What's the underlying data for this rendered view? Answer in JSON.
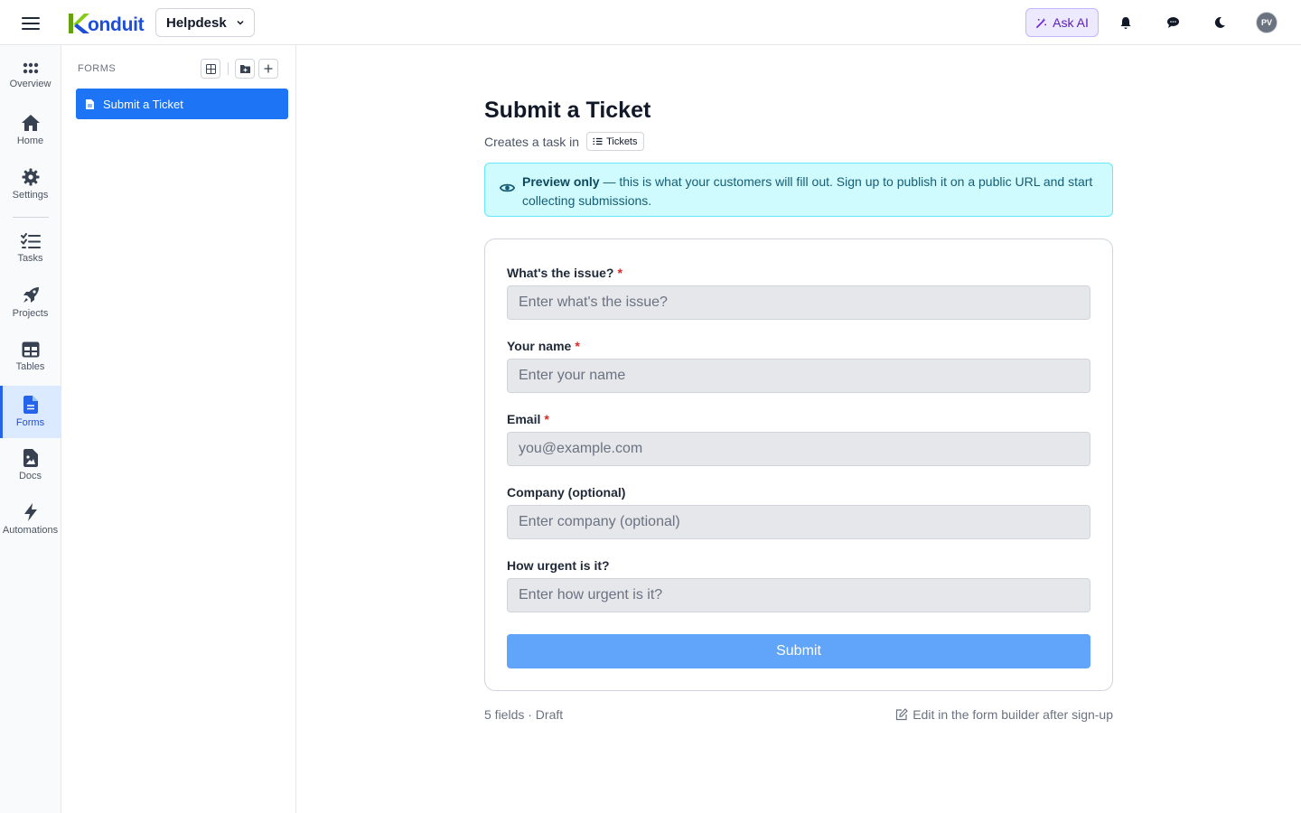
{
  "topbar": {
    "logo_text": "onduit",
    "logo_letter": "K",
    "workspace": "Helpdesk",
    "ask_ai_label": "Ask AI",
    "avatar_initials": "PV"
  },
  "rail": {
    "items": [
      {
        "label": "Overview",
        "icon": "grid-icon"
      },
      {
        "label": "Home",
        "icon": "home-icon"
      },
      {
        "label": "Settings",
        "icon": "gear-icon"
      },
      {
        "label": "Tasks",
        "icon": "checklist-icon"
      },
      {
        "label": "Projects",
        "icon": "rocket-icon"
      },
      {
        "label": "Tables",
        "icon": "table-icon"
      },
      {
        "label": "Forms",
        "icon": "file-icon",
        "active": true
      },
      {
        "label": "Docs",
        "icon": "document-image-icon"
      },
      {
        "label": "Automations",
        "icon": "bolt-icon"
      }
    ]
  },
  "panel": {
    "title": "FORMS",
    "items": [
      {
        "label": "Submit a Ticket",
        "active": true
      }
    ]
  },
  "form": {
    "title": "Submit a Ticket",
    "subtitle_prefix": "Creates a task in",
    "target_table": "Tickets",
    "notice_bold": "Preview only",
    "notice_text": " — this is what your customers will fill out. Sign up to publish it on a public URL and start collecting submissions.",
    "fields": [
      {
        "label": "What's the issue?",
        "required": "*",
        "placeholder": "Enter what's the issue?"
      },
      {
        "label": "Your name",
        "required": "*",
        "placeholder": "Enter your name"
      },
      {
        "label": "Email",
        "required": "*",
        "placeholder": "you@example.com"
      },
      {
        "label": "Company (optional)",
        "required": "",
        "placeholder": "Enter company (optional)"
      },
      {
        "label": "How urgent is it?",
        "required": "",
        "placeholder": "Enter how urgent is it?"
      }
    ],
    "submit_label": "Submit",
    "footer_status": "5 fields · Draft",
    "footer_edit": "Edit in the form builder after sign-up"
  },
  "colors": {
    "primary": "#1d74f5",
    "notice_bg": "#cffafe",
    "submit_bg": "#60a5fa",
    "ai_bg": "#ede9fe"
  }
}
